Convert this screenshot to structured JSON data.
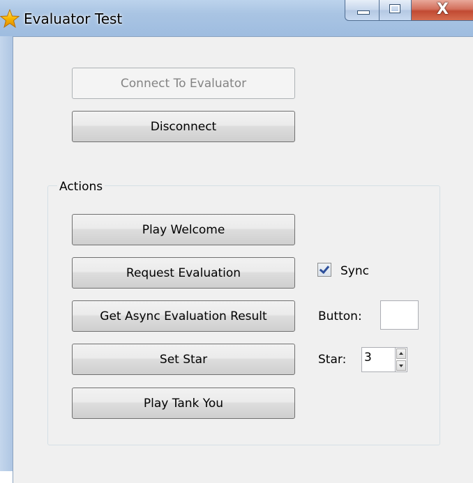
{
  "window": {
    "title": "Evaluator Test",
    "icon": "star-icon",
    "controls": {
      "minimize": "minimize-icon",
      "maximize": "maximize-icon",
      "close": "X"
    }
  },
  "connection": {
    "connect_label": "Connect To Evaluator",
    "connect_enabled": false,
    "disconnect_label": "Disconnect"
  },
  "actions": {
    "group_label": "Actions",
    "play_welcome_label": "Play Welcome",
    "request_evaluation_label": "Request Evaluation",
    "get_async_result_label": "Get Async Evaluation Result",
    "set_star_label": "Set Star",
    "play_tank_you_label": "Play Tank You",
    "sync": {
      "label": "Sync",
      "checked": true
    },
    "button_field": {
      "label": "Button:",
      "value": ""
    },
    "star_field": {
      "label": "Star:",
      "value": "3"
    }
  },
  "colors": {
    "accent_checkmark": "#2d4f9b",
    "disabled_text": "#838383",
    "star_icon": "#f5b400"
  }
}
